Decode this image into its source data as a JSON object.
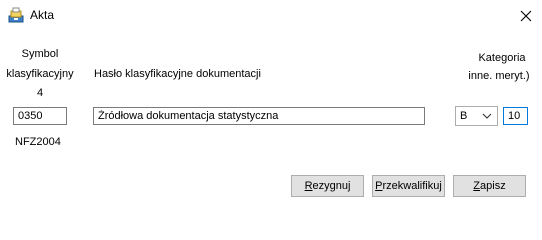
{
  "window": {
    "title": "Akta"
  },
  "symbol": {
    "header_line1": "Symbol",
    "header_line2": "klasyfikacyjny",
    "level": "4",
    "value": "0350",
    "code": "NFZ2004"
  },
  "haslo": {
    "header": "Hasło klasyfikacyjne dokumentacji",
    "value": "Źródłowa dokumentacja statystyczna"
  },
  "kategoria": {
    "header_line1": "Kategoria",
    "header_line2": "inne. meryt.)",
    "select_value": "B",
    "number_value": "10"
  },
  "buttons": {
    "cancel": {
      "first": "R",
      "rest": "ezygnuj"
    },
    "reclassify": {
      "first": "P",
      "rest": "rzekwalifikuj"
    },
    "save": {
      "first": "Z",
      "rest": "apisz"
    }
  },
  "icons": {
    "app": "archive-icon",
    "close": "close-icon",
    "dropdown": "chevron-down-icon"
  },
  "colors": {
    "focus_border": "#0078d7",
    "button_face": "#e1e1e1"
  }
}
